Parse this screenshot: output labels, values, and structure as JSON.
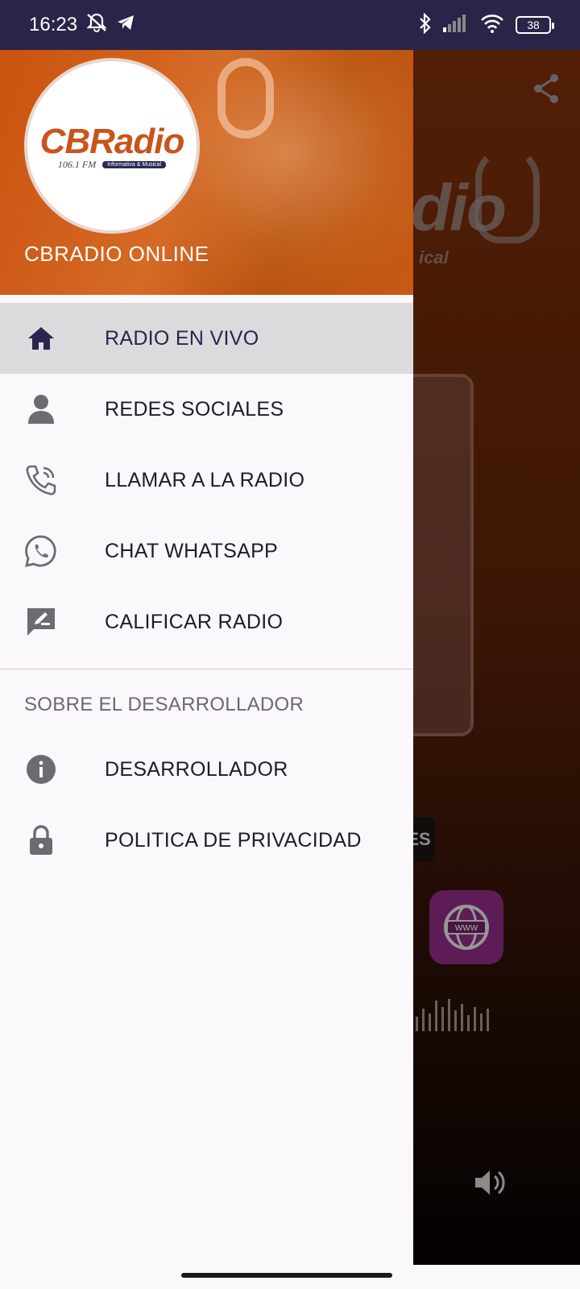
{
  "status_bar": {
    "time": "16:23",
    "battery": "38"
  },
  "drawer": {
    "header": {
      "logo_text": "CBRadio",
      "logo_freq": "106.1 FM",
      "logo_tagline": "Informativa & Musical",
      "title": "CBRADIO ONLINE"
    },
    "items": [
      {
        "label": "RADIO EN VIVO",
        "icon": "home-icon",
        "active": true
      },
      {
        "label": "REDES SOCIALES",
        "icon": "person-icon"
      },
      {
        "label": "LLAMAR A LA RADIO",
        "icon": "phone-call-icon"
      },
      {
        "label": "CHAT WHATSAPP",
        "icon": "whatsapp-icon"
      },
      {
        "label": "CALIFICAR RADIO",
        "icon": "rate-review-icon"
      }
    ],
    "section_title": "SOBRE EL DESARROLLADOR",
    "dev_items": [
      {
        "label": "DESARROLLADOR",
        "icon": "info-icon"
      },
      {
        "label": "POLITICA DE PRIVACIDAD",
        "icon": "lock-icon"
      }
    ]
  },
  "background": {
    "logo_partial": "dio",
    "logo_sub_partial": "ical",
    "pill_partial": "ES",
    "www_label": "WWW"
  },
  "colors": {
    "accent": "#c9541a",
    "status_bar": "#2a2448",
    "drawer_bg": "#fbf8fb",
    "active_row": "#dcdadc"
  }
}
